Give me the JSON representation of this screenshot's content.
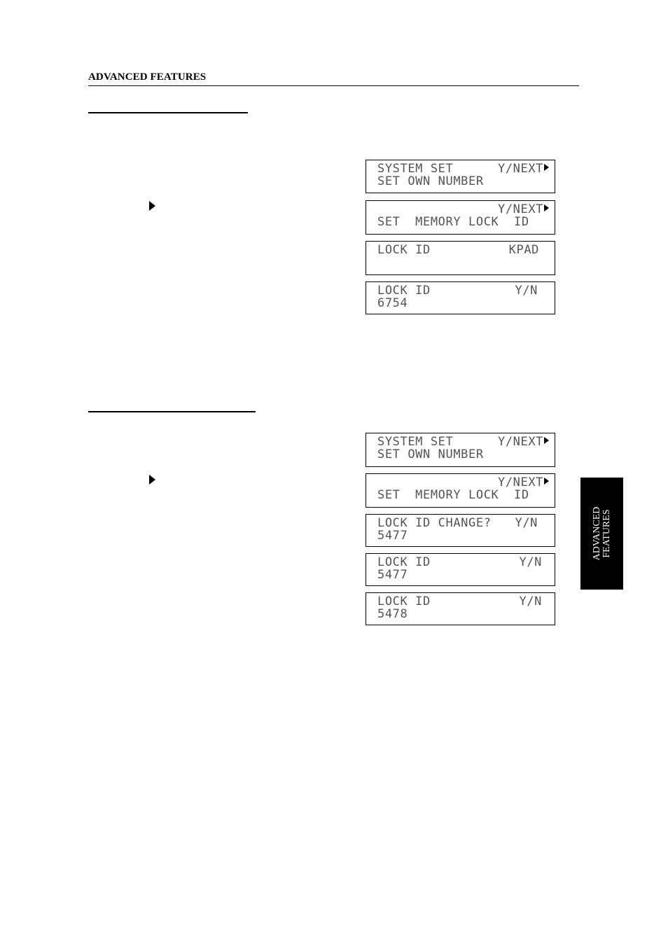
{
  "header": {
    "title": "ADVANCED FEATURES"
  },
  "side_tab": {
    "line1": "ADVANCED",
    "line2": "FEATURES"
  },
  "sections": [
    {
      "displays": [
        {
          "line1_left": "SYSTEM SET",
          "line1_right": "Y/NEXT",
          "line1_arrow": true,
          "line2": "SET OWN NUMBER"
        },
        {
          "line1_left": "",
          "line1_right": "Y/NEXT",
          "line1_arrow": true,
          "line2": "SET  MEMORY LOCK  ID"
        },
        {
          "line1_left": "LOCK ID",
          "line1_right": "KPAD",
          "line1_arrow": false,
          "line2": ""
        },
        {
          "line1_left": "LOCK ID",
          "line1_right": "Y/N",
          "line1_arrow": false,
          "line2": "6754"
        }
      ]
    },
    {
      "displays": [
        {
          "line1_left": "SYSTEM SET",
          "line1_right": "Y/NEXT",
          "line1_arrow": true,
          "line2": "SET OWN NUMBER"
        },
        {
          "line1_left": "",
          "line1_right": "Y/NEXT",
          "line1_arrow": true,
          "line2": "SET  MEMORY LOCK  ID"
        },
        {
          "line1_left": "LOCK ID CHANGE?",
          "line1_right": "Y/N",
          "line1_arrow": false,
          "line2": "5477"
        },
        {
          "line1_left": "LOCK ID",
          "line1_right": "Y/N",
          "line1_arrow": false,
          "line2": "5477"
        },
        {
          "line1_left": "LOCK ID",
          "line1_right": "Y/N",
          "line1_arrow": false,
          "line2": "5478"
        }
      ]
    }
  ]
}
